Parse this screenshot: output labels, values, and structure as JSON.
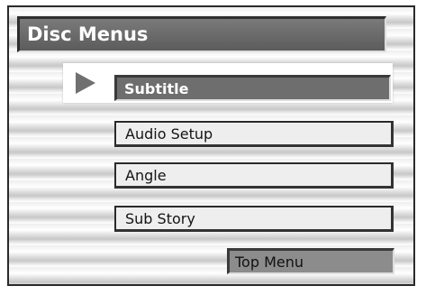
{
  "title": "Disc Menus",
  "selected_indicator_icon": "triangle-right-icon",
  "menu": {
    "items": [
      {
        "label": "Subtitle",
        "selected": true
      },
      {
        "label": "Audio Setup",
        "selected": false
      },
      {
        "label": "Angle",
        "selected": false
      },
      {
        "label": "Sub Story",
        "selected": false
      }
    ],
    "top_menu_label": "Top Menu"
  },
  "colors": {
    "selected_fill": "#6e6e6e",
    "button_fill": "#eeeeee",
    "title_fill": "#6a6a6a"
  }
}
